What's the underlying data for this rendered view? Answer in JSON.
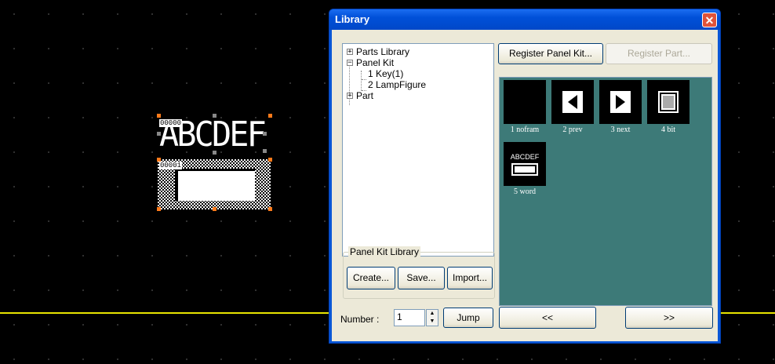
{
  "canvas": {
    "text_object": {
      "id_tag": "00000",
      "text": "ABCDEF"
    },
    "lamp_object": {
      "id_tag": "00001"
    }
  },
  "dialog": {
    "title": "Library",
    "close_glyph": "✕",
    "tree": {
      "items": [
        {
          "label": "Parts Library",
          "expander": "+"
        },
        {
          "label": "Panel Kit",
          "expander": "−"
        },
        {
          "label": "1 Key(1)"
        },
        {
          "label": "2 LampFigure"
        },
        {
          "label": "Part",
          "expander": "+"
        }
      ]
    },
    "buttons": {
      "register_panel_kit": "Register Panel Kit...",
      "register_part": "Register Part..."
    },
    "parts": [
      {
        "label": "1 nofram",
        "icon": "blank-icon"
      },
      {
        "label": "2 prev",
        "icon": "prev-arrow-icon"
      },
      {
        "label": "3 next",
        "icon": "next-arrow-icon"
      },
      {
        "label": "4 bit",
        "icon": "bit-square-icon"
      },
      {
        "label": "5 word",
        "icon": "word-lamp-icon",
        "preview_text": "ABCDEF"
      }
    ],
    "panel_kit_library": {
      "legend": "Panel Kit Library",
      "create": "Create...",
      "save": "Save...",
      "import": "Import..."
    },
    "footer": {
      "number_label": "Number :",
      "number_value": "1",
      "jump": "Jump",
      "prev": "<<",
      "next": ">>"
    }
  },
  "colors": {
    "canvas_bg": "#000000",
    "baseline": "#e8e400",
    "parts_panel_bg": "#3d7a78",
    "titlebar": "#0050d8",
    "handle": "#ff7a1a"
  }
}
